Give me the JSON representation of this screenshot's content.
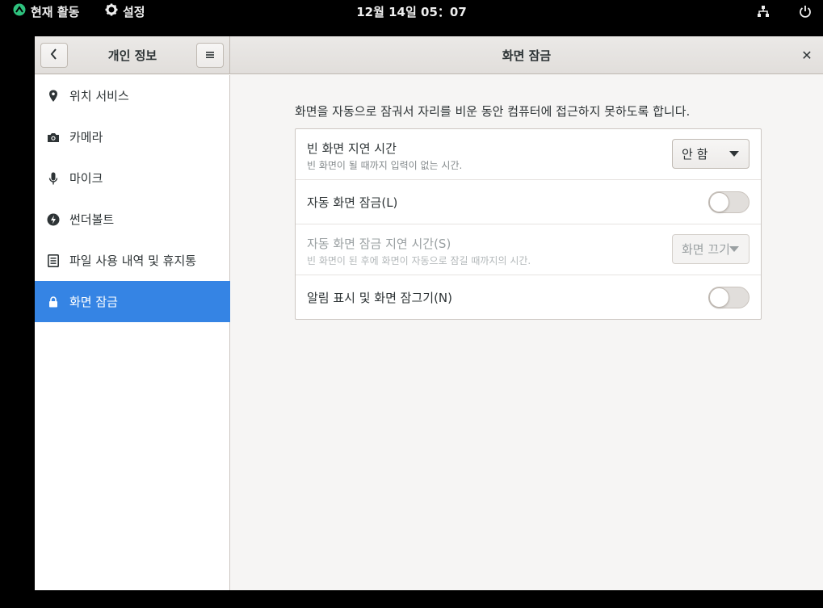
{
  "topbar": {
    "activities": "현재 활동",
    "app_name": "설정",
    "clock": "12월 14일  05：07",
    "network_icon": "network-wired-icon",
    "power_icon": "power-icon"
  },
  "headerbar": {
    "left_title": "개인 정보",
    "title": "화면 잠금",
    "close_glyph": "✕"
  },
  "sidebar": {
    "items": [
      {
        "label": "위치 서비스",
        "icon": "location-pin-icon"
      },
      {
        "label": "카메라",
        "icon": "camera-icon"
      },
      {
        "label": "마이크",
        "icon": "microphone-icon"
      },
      {
        "label": "썬더볼트",
        "icon": "thunderbolt-icon"
      },
      {
        "label": "파일 사용 내역 및 휴지통",
        "icon": "file-history-icon"
      },
      {
        "label": "화면 잠금",
        "icon": "lock-icon",
        "active": true
      }
    ]
  },
  "main": {
    "description": "화면을 자동으로 잠궈서 자리를 비운 동안 컴퓨터에 접근하지 못하도록 합니다.",
    "rows": [
      {
        "title": "빈 화면 지연 시간",
        "subtitle": "빈 화면이 될 때까지 입력이 없는 시간.",
        "combo_value": "안 함"
      },
      {
        "title": "자동 화면 잠금(L)",
        "switch_on": false
      },
      {
        "title": "자동 화면 잠금 지연 시간(S)",
        "subtitle": "빈 화면이 된 후에 화면이 자동으로 잠길 때까지의 시간.",
        "combo_value": "화면 끄기",
        "disabled": true
      },
      {
        "title": "알림 표시 및 화면 잠그기(N)",
        "switch_on": false
      }
    ]
  },
  "colors": {
    "accent": "#3584e4",
    "topbar_bg": "#000000",
    "window_bg": "#f6f5f4"
  }
}
